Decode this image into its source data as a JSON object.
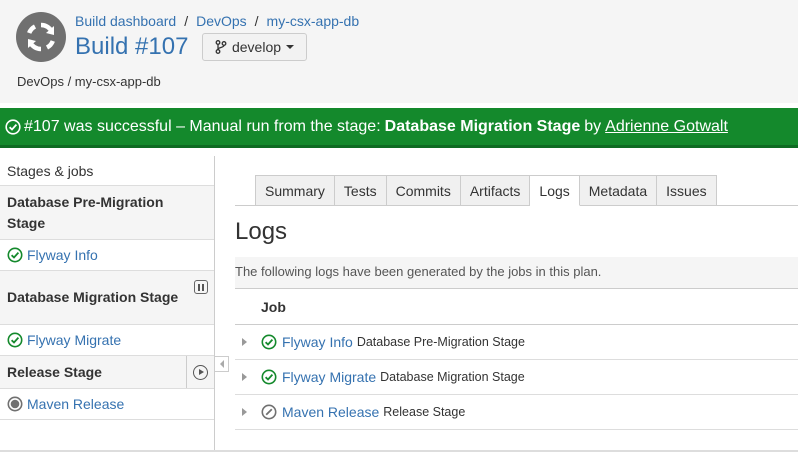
{
  "breadcrumbs": {
    "items": [
      "Build dashboard",
      "DevOps",
      "my-csx-app-db"
    ],
    "separator": "/"
  },
  "build": {
    "title": "Build #107",
    "branch": "develop",
    "subpath": "DevOps / my-csx-app-db"
  },
  "status": {
    "prefix": "#107 was successful – Manual run from the stage:",
    "stage": "Database Migration Stage",
    "by": "by",
    "user": "Adrienne Gotwalt",
    "color": "#14892c"
  },
  "sidebar": {
    "heading": "Stages & jobs",
    "stages": [
      {
        "name": "Database Pre-Migration Stage",
        "control": "",
        "jobs": [
          {
            "name": "Flyway Info",
            "state": "success"
          }
        ]
      },
      {
        "name": "Database Migration Stage",
        "control": "pause-icon",
        "jobs": [
          {
            "name": "Flyway Migrate",
            "state": "success"
          }
        ]
      },
      {
        "name": "Release Stage",
        "control": "play-icon",
        "jobs": [
          {
            "name": "Maven Release",
            "state": "not-run"
          }
        ]
      }
    ]
  },
  "tabs": [
    {
      "label": "Summary",
      "active": false
    },
    {
      "label": "Tests",
      "active": false
    },
    {
      "label": "Commits",
      "active": false
    },
    {
      "label": "Artifacts",
      "active": false
    },
    {
      "label": "Logs",
      "active": true
    },
    {
      "label": "Metadata",
      "active": false
    },
    {
      "label": "Issues",
      "active": false
    }
  ],
  "logs": {
    "title": "Logs",
    "description": "The following logs have been generated by the jobs in this plan.",
    "column_job": "Job",
    "rows": [
      {
        "job": "Flyway Info",
        "stage": "Database Pre-Migration Stage",
        "state": "success"
      },
      {
        "job": "Flyway Migrate",
        "stage": "Database Migration Stage",
        "state": "success"
      },
      {
        "job": "Maven Release",
        "stage": "Release Stage",
        "state": "not-run"
      }
    ]
  },
  "colors": {
    "link": "#3572b0",
    "success": "#14892c",
    "not_run": "#707070"
  }
}
